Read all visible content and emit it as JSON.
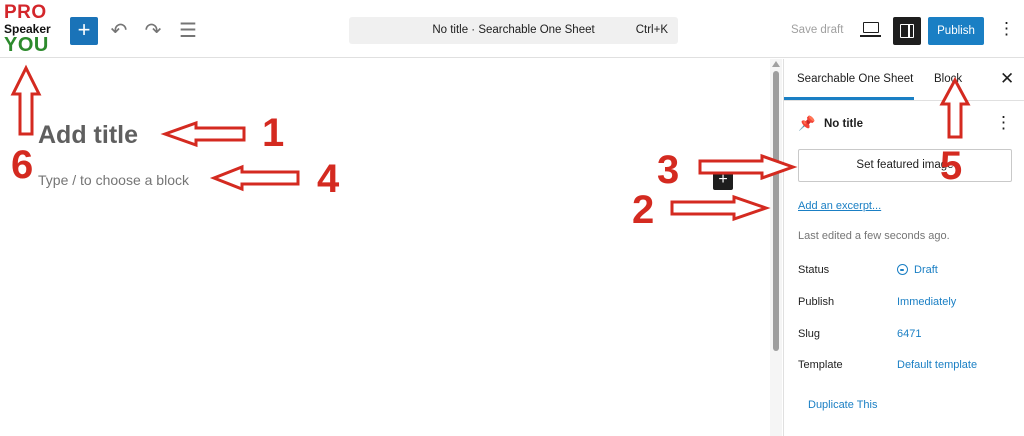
{
  "logo": {
    "line1": "PRO",
    "line2": "Speaker",
    "line3": "YOU"
  },
  "toolbar": {
    "add_glyph": "+",
    "undo_glyph": "↶",
    "redo_glyph": "↷",
    "list_view_glyph": "☰",
    "command_bar_text": "No title · Searchable One Sheet",
    "command_bar_shortcut": "Ctrl+K",
    "save_draft_label": "Save draft",
    "publish_label": "Publish",
    "options_glyph": "⋮"
  },
  "editor": {
    "title_placeholder": "Add title",
    "block_placeholder": "Type / to choose a block",
    "inserter_glyph": "+"
  },
  "sidebar": {
    "tab_post": "Searchable One Sheet",
    "tab_block": "Block",
    "close_glyph": "✕",
    "pin_glyph": "📌",
    "post_title": "No title",
    "more_glyph": "⋮",
    "featured_image_label": "Set featured image",
    "excerpt_link": "Add an excerpt...",
    "last_edited": "Last edited a few seconds ago.",
    "rows": [
      {
        "label": "Status",
        "value": "Draft"
      },
      {
        "label": "Publish",
        "value": "Immediately"
      },
      {
        "label": "Slug",
        "value": "6471"
      },
      {
        "label": "Template",
        "value": "Default template"
      }
    ],
    "duplicate_link": "Duplicate This"
  },
  "annotations": {
    "numbers": [
      "1",
      "2",
      "3",
      "4",
      "5",
      "6"
    ],
    "color": "#d42a20"
  }
}
